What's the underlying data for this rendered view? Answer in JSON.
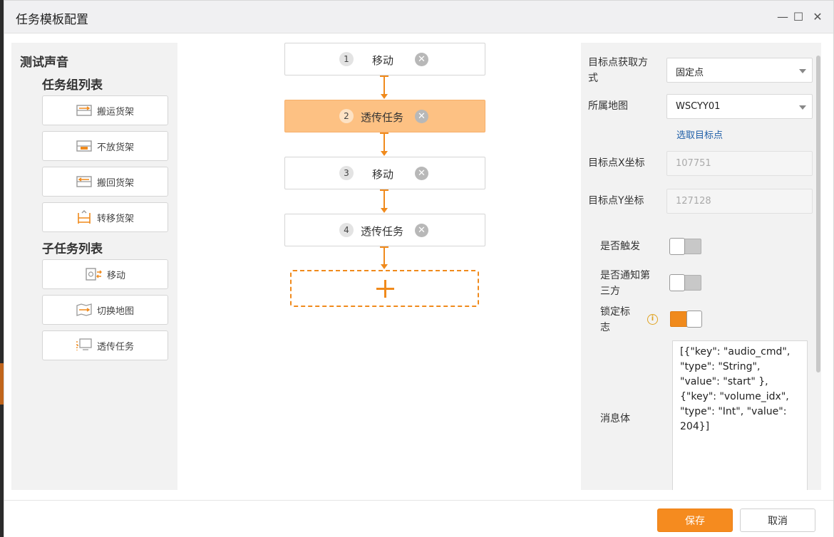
{
  "window": {
    "title": "任务模板配置",
    "minimize": "—",
    "maximize": "☐",
    "close": "✕"
  },
  "left": {
    "template_name": "测试声音",
    "group_list_title": "任务组列表",
    "group_items": [
      {
        "label": "搬运货架",
        "icon": "carry-shelf-icon"
      },
      {
        "label": "不放货架",
        "icon": "no-place-shelf-icon"
      },
      {
        "label": "搬回货架",
        "icon": "return-shelf-icon"
      },
      {
        "label": "转移货架",
        "icon": "transfer-shelf-icon"
      }
    ],
    "subtask_list_title": "子任务列表",
    "subtask_items": [
      {
        "label": "移动",
        "icon": "move-icon"
      },
      {
        "label": "切换地图",
        "icon": "switch-map-icon"
      },
      {
        "label": "透传任务",
        "icon": "passthrough-task-icon"
      }
    ]
  },
  "flow": {
    "nodes": [
      {
        "num": "1",
        "label": "移动",
        "active": false
      },
      {
        "num": "2",
        "label": "透传任务",
        "active": true
      },
      {
        "num": "3",
        "label": "移动",
        "active": false
      },
      {
        "num": "4",
        "label": "透传任务",
        "active": false
      }
    ],
    "add_symbol": "+"
  },
  "right": {
    "target_mode_label": "目标点获取方式",
    "target_mode_value": "固定点",
    "map_label": "所属地图",
    "map_value": "WSCYY01",
    "pick_target_link": "选取目标点",
    "x_label": "目标点X坐标",
    "x_value": "107751",
    "y_label": "目标点Y坐标",
    "y_value": "127128",
    "trigger_label": "是否触发",
    "trigger_on": false,
    "notify_label": "是否通知第三方",
    "notify_on": false,
    "lock_label": "锁定标志",
    "lock_on": true,
    "message_label": "消息体",
    "message_value": "[{\"key\": \"audio_cmd\", \"type\": \"String\", \"value\": \"start\" }, {\"key\": \"volume_idx\", \"type\": \"Int\", \"value\": 204}]"
  },
  "footer": {
    "save": "保存",
    "cancel": "取消"
  },
  "colors": {
    "accent": "#f58b1f",
    "active_node": "#fdc183",
    "panel_bg": "#f2f2f2"
  }
}
